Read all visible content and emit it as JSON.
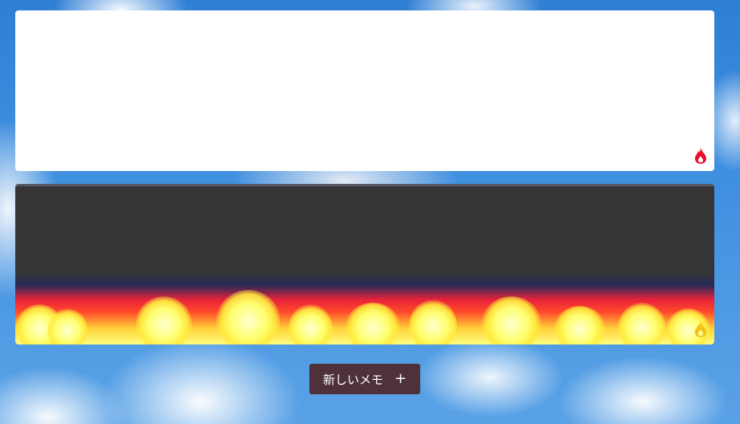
{
  "memos": [
    {
      "text": "",
      "theme": "light",
      "burn_icon": "flame-icon",
      "burn_icon_color": "#e8102a"
    },
    {
      "text": "",
      "theme": "dark-burning",
      "burn_icon": "flame-icon",
      "burn_icon_color": "#f2c218"
    }
  ],
  "new_memo_button": {
    "label": "新しいメモ",
    "icon": "plus-icon",
    "icon_glyph": "+",
    "background": "#4f3239"
  },
  "colors": {
    "sky": "#3f8fe0",
    "fire_red": "#e8233a",
    "fire_yellow": "#ffff80"
  }
}
